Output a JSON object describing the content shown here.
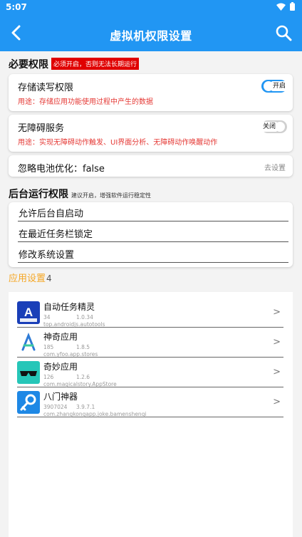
{
  "status": {
    "time": "5:07"
  },
  "appbar": {
    "title": "虚拟机权限设置"
  },
  "required": {
    "title": "必要权限",
    "badge": "必须开启，否则无法长期运行",
    "storage": {
      "title": "存储读写权限",
      "usage": "用途：存储应用功能使用过程中产生的数据",
      "toggle_label": "开启",
      "enabled": true
    },
    "accessibility": {
      "title": "无障碍服务",
      "usage": "用途：实现无障碍动作触发、UI界面分析、无障碍动作唤醒动作",
      "toggle_label": "关闭",
      "enabled": false
    },
    "battery": {
      "label": "忽略电池优化：false",
      "action": "去设置"
    }
  },
  "background": {
    "title": "后台运行权限",
    "note": "建议开启，增强软件运行稳定性",
    "items": [
      "允许后台自启动",
      "在最近任务栏锁定",
      "修改系统设置"
    ]
  },
  "apps": {
    "title": "应用设置",
    "count": "4",
    "items": [
      {
        "name": "自动任务精灵",
        "code": "34",
        "version": "1.0.34",
        "package": "top.androidjs.autotools",
        "icon": "autotask-icon"
      },
      {
        "name": "神奇应用",
        "code": "185",
        "version": "1.8.5",
        "package": "com.yfoo.app.stores",
        "icon": "app-store-a-icon"
      },
      {
        "name": "奇妙应用",
        "code": "126",
        "version": "1.2.6",
        "package": "com.magicalstory.AppStore",
        "icon": "magic-sunglasses-icon"
      },
      {
        "name": "八门神器",
        "code": "3907024",
        "version": "3.9.7.1",
        "package": "com.zhangkongapp.joke.bamenshenqi",
        "icon": "key-magnifier-icon"
      }
    ]
  },
  "colors": {
    "primary": "#2196f3",
    "danger": "#e00000",
    "accent": "#f5a623"
  }
}
